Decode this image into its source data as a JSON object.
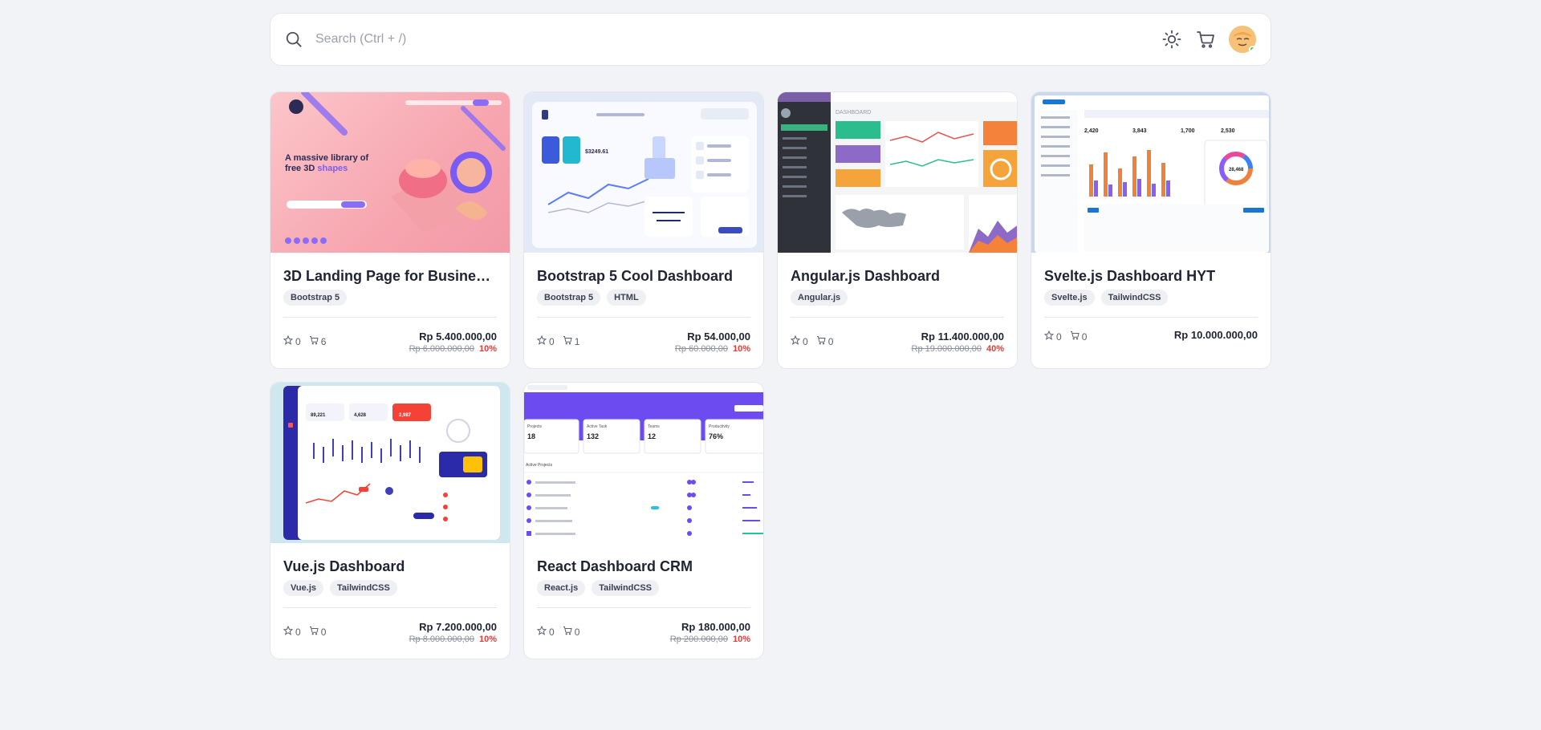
{
  "search": {
    "placeholder": "Search (Ctrl + /)"
  },
  "header": {
    "icons": [
      "search-icon",
      "sun-icon",
      "cart-icon"
    ],
    "status_color": "#2bc155"
  },
  "products": [
    {
      "title": "3D Landing Page for Busine…",
      "tags": [
        "Bootstrap 5"
      ],
      "stars": "0",
      "sales": "6",
      "price": "Rp 5.400.000,00",
      "old_price": "Rp 6.000.000,00",
      "discount": "10%"
    },
    {
      "title": "Bootstrap 5 Cool Dashboard",
      "tags": [
        "Bootstrap 5",
        "HTML"
      ],
      "stars": "0",
      "sales": "1",
      "price": "Rp 54.000,00",
      "old_price": "Rp 60.000,00",
      "discount": "10%"
    },
    {
      "title": "Angular.js Dashboard",
      "tags": [
        "Angular.js"
      ],
      "stars": "0",
      "sales": "0",
      "price": "Rp 11.400.000,00",
      "old_price": "Rp 19.000.000,00",
      "discount": "40%"
    },
    {
      "title": "Svelte.js Dashboard HYT",
      "tags": [
        "Svelte.js",
        "TailwindCSS"
      ],
      "stars": "0",
      "sales": "0",
      "price": "Rp 10.000.000,00",
      "old_price": "",
      "discount": ""
    },
    {
      "title": "Vue.js Dashboard",
      "tags": [
        "Vue.js",
        "TailwindCSS"
      ],
      "stars": "0",
      "sales": "0",
      "price": "Rp 7.200.000,00",
      "old_price": "Rp 8.000.000,00",
      "discount": "10%"
    },
    {
      "title": "React Dashboard CRM",
      "tags": [
        "React.js",
        "TailwindCSS"
      ],
      "stars": "0",
      "sales": "0",
      "price": "Rp 180.000,00",
      "old_price": "Rp 200.000,00",
      "discount": "10%"
    }
  ],
  "thumbnails": {
    "landing": {
      "headline_1": "A massive library of",
      "headline_2": "free 3D",
      "headline_accent": "shapes"
    },
    "react": {
      "section": "Active Projects",
      "kpis": [
        {
          "label": "Projects",
          "value": "18"
        },
        {
          "label": "Active Task",
          "value": "132"
        },
        {
          "label": "Teams",
          "value": "12"
        },
        {
          "label": "Productivity",
          "value": "76%"
        }
      ]
    },
    "svelte": {
      "kpis": [
        "2,420",
        "3,843",
        "1,700",
        "2,530"
      ],
      "donut_value": "28,468"
    },
    "vue": {
      "kpis": [
        "89,221",
        "4,628",
        "2,987"
      ]
    },
    "bootstrap": {
      "kpi": "$3249.61"
    },
    "angular": {
      "heading": "DASHBOARD"
    }
  },
  "colors": {
    "accent": "#7b5cf5",
    "danger": "#e53935",
    "text": "#1f2433",
    "muted": "#5b6170",
    "bg": "#f2f3f6"
  }
}
